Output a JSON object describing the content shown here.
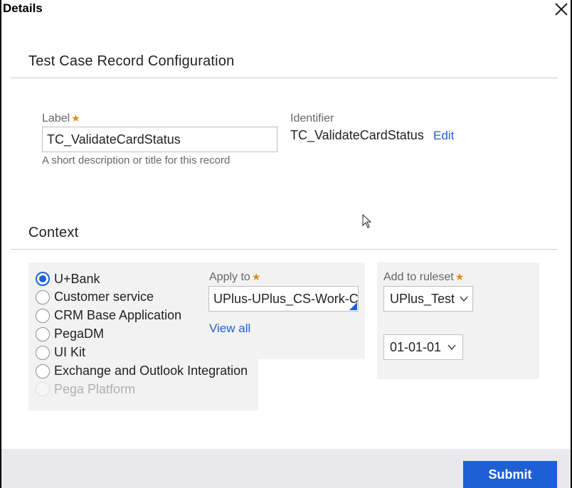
{
  "dialog": {
    "title": "Details"
  },
  "record_config": {
    "section_title": "Test Case Record Configuration",
    "label_field": {
      "label": "Label",
      "required_mark": "★",
      "value": "TC_ValidateCardStatus",
      "helper": "A short description or title for this record"
    },
    "identifier": {
      "label": "Identifier",
      "value": "TC_ValidateCardStatus",
      "edit_link": "Edit"
    }
  },
  "context": {
    "section_title": "Context",
    "applications": [
      {
        "label": "U+Bank",
        "checked": true,
        "disabled": false
      },
      {
        "label": "Customer service",
        "checked": false,
        "disabled": false
      },
      {
        "label": "CRM Base Application",
        "checked": false,
        "disabled": false
      },
      {
        "label": "PegaDM",
        "checked": false,
        "disabled": false
      },
      {
        "label": "UI Kit",
        "checked": false,
        "disabled": false
      },
      {
        "label": "Exchange and Outlook Integration",
        "checked": false,
        "disabled": false
      },
      {
        "label": "Pega Platform",
        "checked": false,
        "disabled": true
      }
    ],
    "apply_to": {
      "label": "Apply to",
      "required_mark": "★",
      "value": "UPlus-UPlus_CS-Work-Cr",
      "view_all": "View all"
    },
    "ruleset": {
      "label": "Add to ruleset",
      "required_mark": "★",
      "value": "UPlus_Test",
      "version": "01-01-01"
    }
  },
  "footer": {
    "submit_label": "Submit"
  },
  "colors": {
    "accent": "#1f5fd6",
    "required": "#e08a14",
    "panel": "#f2f2f2",
    "footer": "#e8e8ed"
  },
  "icons": {
    "close": "close-icon",
    "chevron": "chevron-down-icon",
    "lookup": "lookup-corner-icon",
    "cursor": "mouse-cursor-icon"
  }
}
